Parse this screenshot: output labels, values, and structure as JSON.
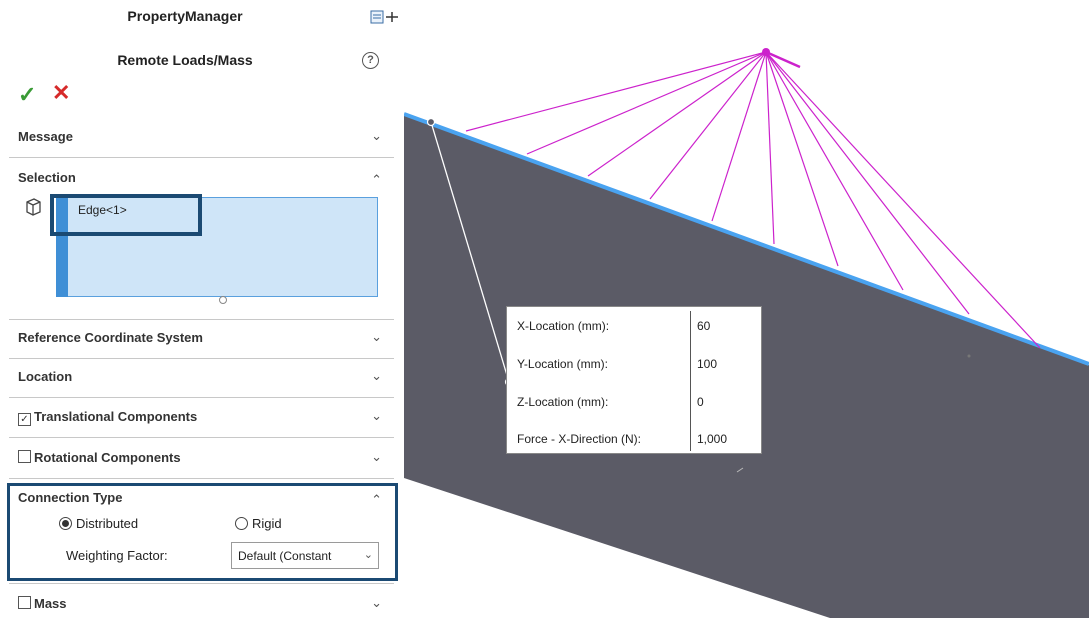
{
  "panel": {
    "header": "PropertyManager",
    "feature_title": "Remote Loads/Mass",
    "help_glyph": "?",
    "ok_glyph": "✓",
    "cancel_glyph": "✕"
  },
  "sections": {
    "message": "Message",
    "selection": "Selection",
    "reference_coordinate_system": "Reference Coordinate System",
    "location": "Location",
    "translational_components": "Translational Components",
    "rotational_components": "Rotational Components",
    "connection_type": "Connection Type",
    "mass": "Mass"
  },
  "checkboxes": {
    "translational_checked": true,
    "rotational_checked": false,
    "mass_checked": false
  },
  "selection": {
    "items": [
      "Edge<1>"
    ]
  },
  "connection": {
    "distributed_label": "Distributed",
    "rigid_label": "Rigid",
    "selected": "Distributed",
    "weighting_label": "Weighting Factor:",
    "weighting_value": "Default (Constant"
  },
  "callout": {
    "rows": [
      {
        "label": "X-Location (mm):",
        "value": "60"
      },
      {
        "label": "Y-Location (mm):",
        "value": "100"
      },
      {
        "label": "Z-Location (mm):",
        "value": "0"
      },
      {
        "label": "Force -  X-Direction (N):",
        "value": "1,000"
      }
    ]
  },
  "colors": {
    "accent": "#1b4a73",
    "selection_fill": "#cfe5f8",
    "face": "#5b5b66",
    "edge": "#4aa3f0",
    "spider": "#cc22cc",
    "ok": "#3a9b36",
    "cancel": "#d62a2a"
  }
}
